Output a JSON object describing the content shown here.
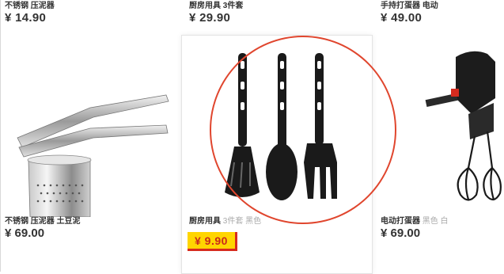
{
  "products": [
    {
      "top_name": "不锈钢 压泥器",
      "top_price": "¥ 14.90",
      "name": "不锈钢 压泥器 土豆泥",
      "name_suffix": "",
      "price": "¥ 69.00",
      "image_icon": "potato-ricer-icon"
    },
    {
      "top_name": "厨房用具 3件套",
      "top_price": "¥ 29.90",
      "name": "厨房用具",
      "name_suffix": "3件套 黑色",
      "price": "¥ 9.90",
      "image_icon": "kitchen-utensils-icon",
      "highlighted": true
    },
    {
      "top_name": "手持打蛋器 电动",
      "top_price": "¥ 49.00",
      "name": "电动打蛋器",
      "name_suffix": "黑色 白",
      "price": "¥ 69.00",
      "image_icon": "hand-mixer-icon"
    }
  ],
  "colors": {
    "price_tag_bg": "#ffd500",
    "price_tag_text": "#c9281d",
    "annotation_circle": "#e0462e"
  }
}
